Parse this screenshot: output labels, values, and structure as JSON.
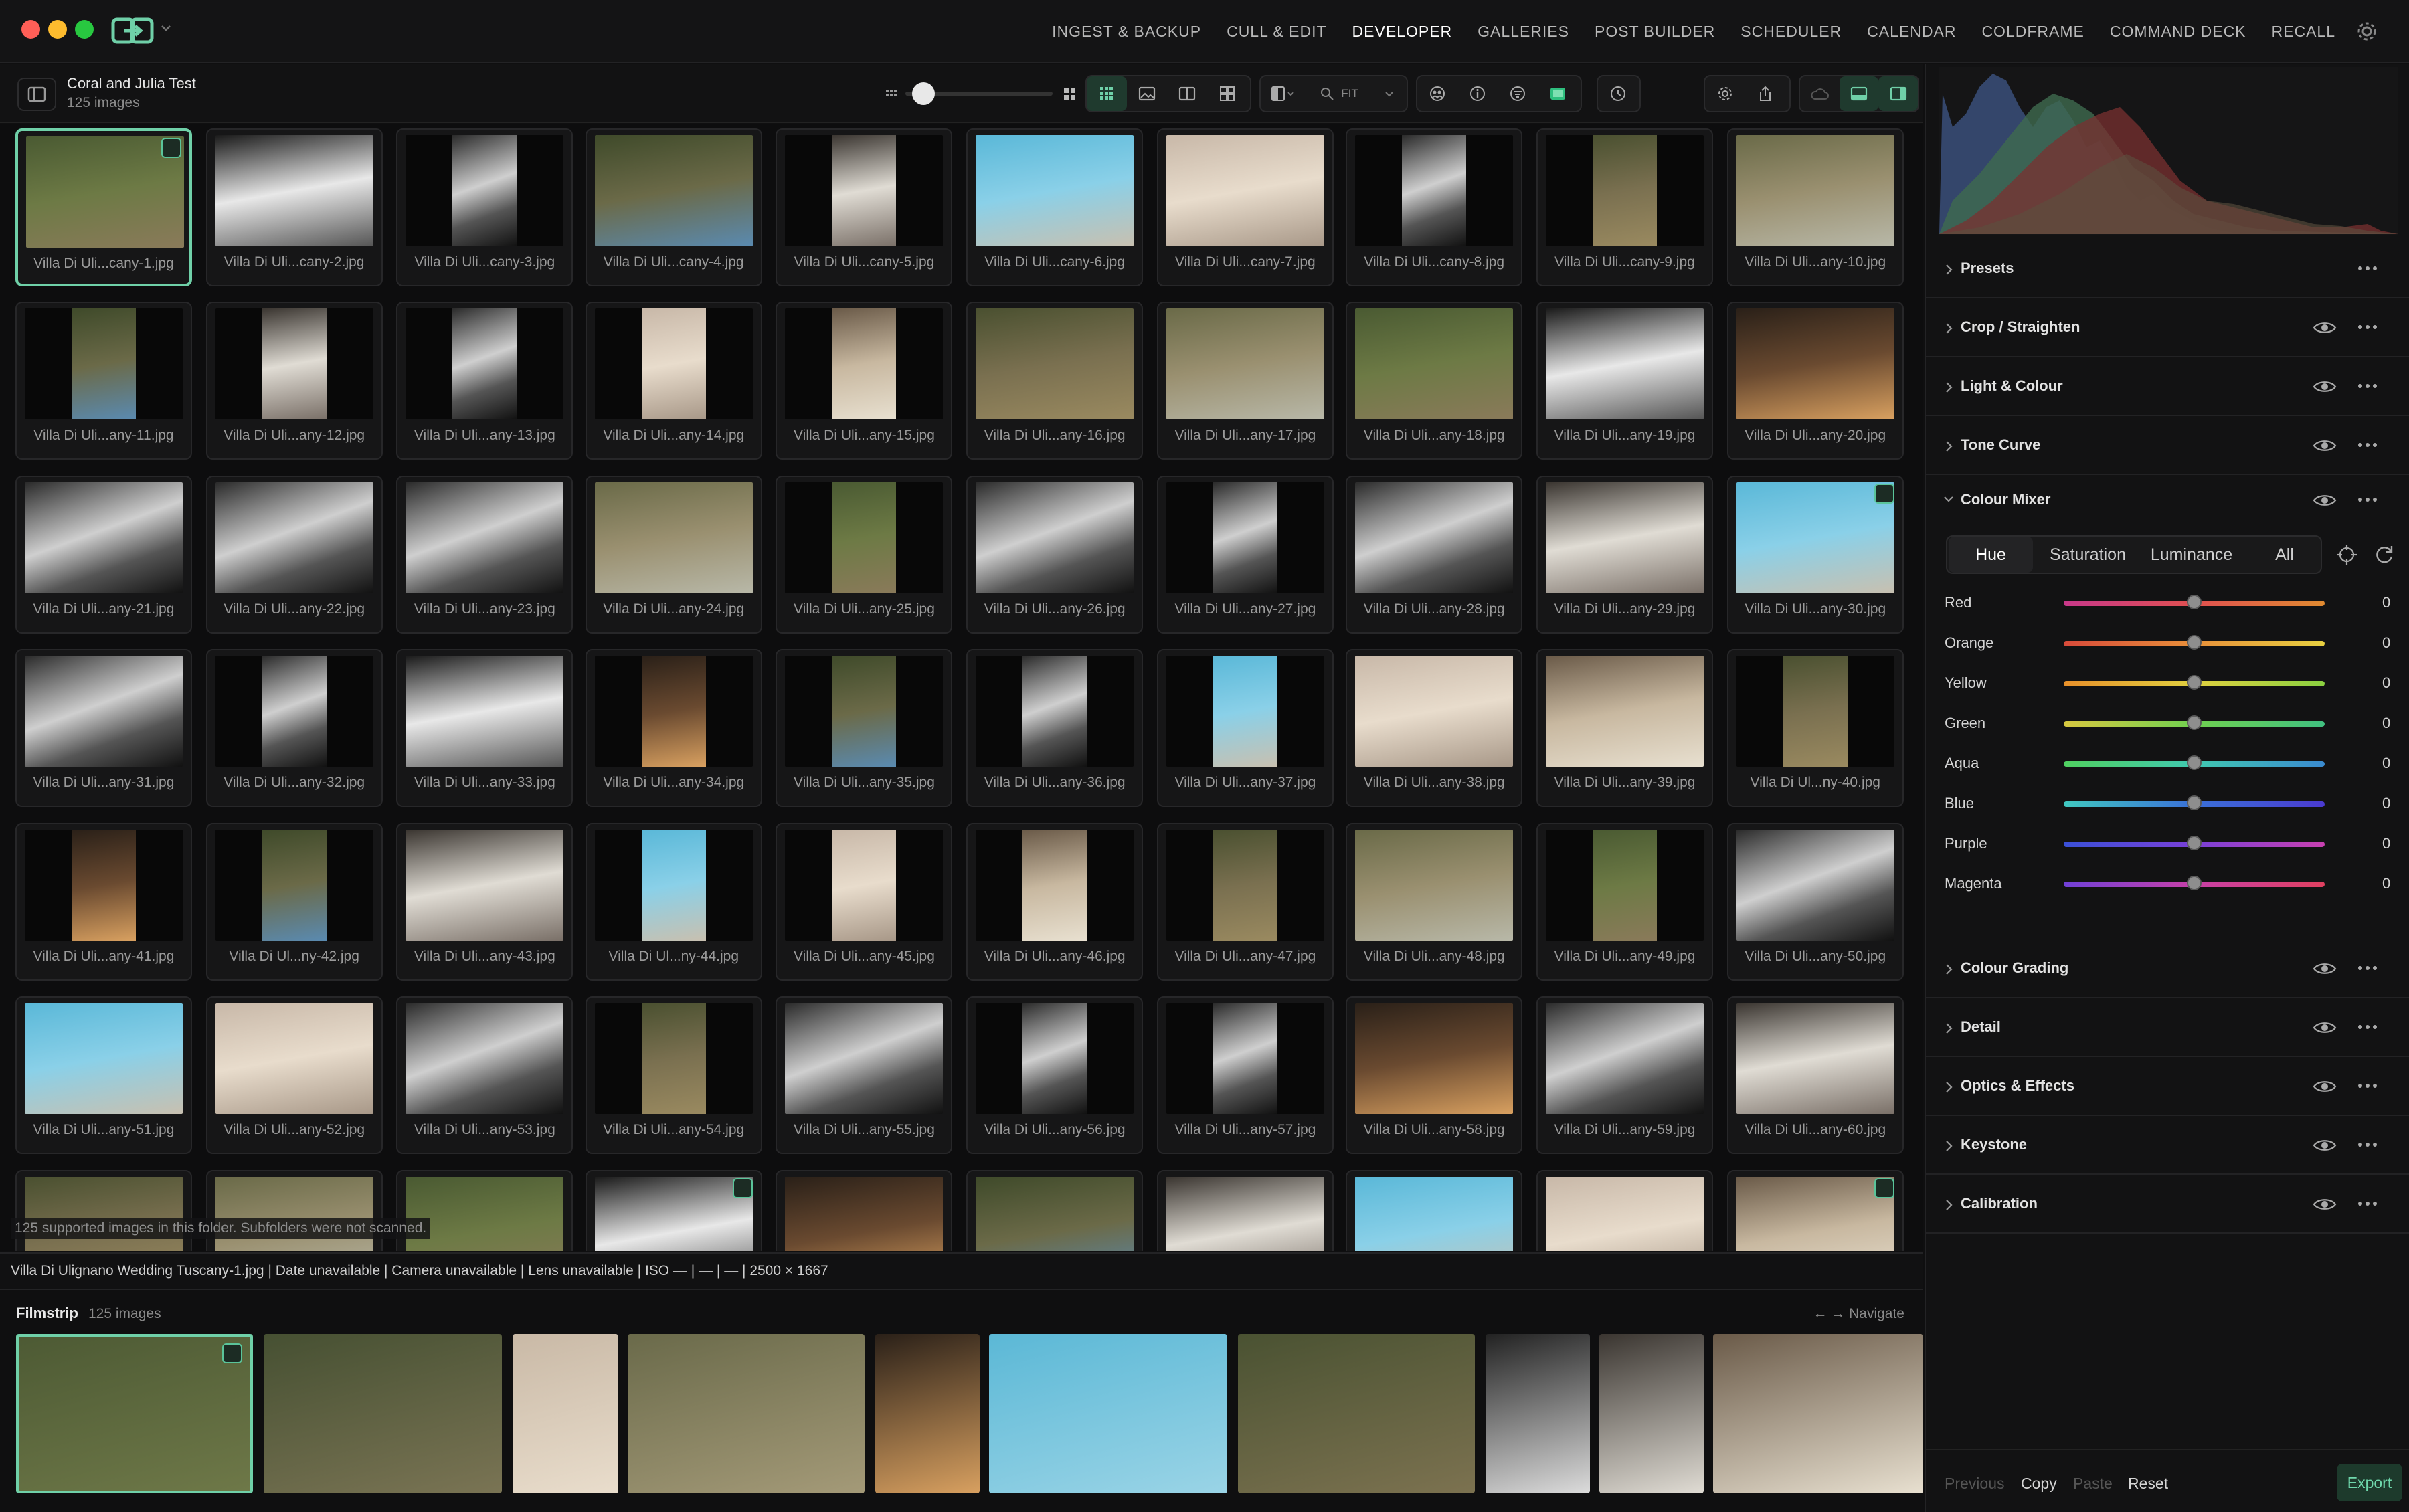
{
  "window": {
    "traffic_colors": [
      "#ff5f57",
      "#febc2e",
      "#28c840"
    ]
  },
  "nav": [
    {
      "label": "INGEST & BACKUP",
      "active": false
    },
    {
      "label": "CULL & EDIT",
      "active": false
    },
    {
      "label": "DEVELOPER",
      "active": true
    },
    {
      "label": "GALLERIES",
      "active": false
    },
    {
      "label": "POST BUILDER",
      "active": false
    },
    {
      "label": "SCHEDULER",
      "active": false
    },
    {
      "label": "CALENDAR",
      "active": false
    },
    {
      "label": "COLDFRAME",
      "active": false
    },
    {
      "label": "COMMAND DECK",
      "active": false
    },
    {
      "label": "RECALL",
      "active": false
    }
  ],
  "folder": {
    "name": "Coral and Julia Test",
    "count": "125 images"
  },
  "toolbar": {
    "fit_label": "FIT",
    "zoom_value": 0.1
  },
  "thumbnails": [
    "Villa Di Uli...cany-1.jpg",
    "Villa Di Uli...cany-2.jpg",
    "Villa Di Uli...cany-3.jpg",
    "Villa Di Uli...cany-4.jpg",
    "Villa Di Uli...cany-5.jpg",
    "Villa Di Uli...cany-6.jpg",
    "Villa Di Uli...cany-7.jpg",
    "Villa Di Uli...cany-8.jpg",
    "Villa Di Uli...cany-9.jpg",
    "Villa Di Uli...any-10.jpg",
    "Villa Di Uli...any-11.jpg",
    "Villa Di Uli...any-12.jpg",
    "Villa Di Uli...any-13.jpg",
    "Villa Di Uli...any-14.jpg",
    "Villa Di Uli...any-15.jpg",
    "Villa Di Uli...any-16.jpg",
    "Villa Di Uli...any-17.jpg",
    "Villa Di Uli...any-18.jpg",
    "Villa Di Uli...any-19.jpg",
    "Villa Di Uli...any-20.jpg",
    "Villa Di Uli...any-21.jpg",
    "Villa Di Uli...any-22.jpg",
    "Villa Di Uli...any-23.jpg",
    "Villa Di Uli...any-24.jpg",
    "Villa Di Uli...any-25.jpg",
    "Villa Di Uli...any-26.jpg",
    "Villa Di Uli...any-27.jpg",
    "Villa Di Uli...any-28.jpg",
    "Villa Di Uli...any-29.jpg",
    "Villa Di Uli...any-30.jpg",
    "Villa Di Uli...any-31.jpg",
    "Villa Di Uli...any-32.jpg",
    "Villa Di Uli...any-33.jpg",
    "Villa Di Uli...any-34.jpg",
    "Villa Di Uli...any-35.jpg",
    "Villa Di Uli...any-36.jpg",
    "Villa Di Uli...any-37.jpg",
    "Villa Di Uli...any-38.jpg",
    "Villa Di Uli...any-39.jpg",
    "Villa Di Ul...ny-40.jpg",
    "Villa Di Uli...any-41.jpg",
    "Villa Di Ul...ny-42.jpg",
    "Villa Di Uli...any-43.jpg",
    "Villa Di Ul...ny-44.jpg",
    "Villa Di Uli...any-45.jpg",
    "Villa Di Uli...any-46.jpg",
    "Villa Di Uli...any-47.jpg",
    "Villa Di Uli...any-48.jpg",
    "Villa Di Uli...any-49.jpg",
    "Villa Di Uli...any-50.jpg",
    "Villa Di Uli...any-51.jpg",
    "Villa Di Uli...any-52.jpg",
    "Villa Di Uli...any-53.jpg",
    "Villa Di Uli...any-54.jpg",
    "Villa Di Uli...any-55.jpg",
    "Villa Di Uli...any-56.jpg",
    "Villa Di Uli...any-57.jpg",
    "Villa Di Uli...any-58.jpg",
    "Villa Di Uli...any-59.jpg",
    "Villa Di Uli...any-60.jpg",
    "",
    "",
    "",
    "",
    "",
    "",
    "",
    "",
    "",
    ""
  ],
  "grid_note": "125 supported images in this folder. Subfolders were not scanned.",
  "status_line": "Villa Di Ulignano Wedding Tuscany-1.jpg | Date unavailable | Camera unavailable | Lens unavailable | ISO — | — | — | 2500 × 1667",
  "filmstrip": {
    "title": "Filmstrip",
    "count": "125 images",
    "nav_hint": "← → Navigate"
  },
  "panel": {
    "sections_top": [
      {
        "title": "Presets",
        "has_eye": false
      },
      {
        "title": "Crop / Straighten",
        "has_eye": true
      },
      {
        "title": "Light & Colour",
        "has_eye": true
      },
      {
        "title": "Tone Curve",
        "has_eye": true
      }
    ],
    "mixer": {
      "title": "Colour Mixer",
      "tabs": [
        "Hue",
        "Saturation",
        "Luminance",
        "All"
      ],
      "active_tab": "Hue",
      "rows": [
        {
          "label": "Red",
          "value": "0"
        },
        {
          "label": "Orange",
          "value": "0"
        },
        {
          "label": "Yellow",
          "value": "0"
        },
        {
          "label": "Green",
          "value": "0"
        },
        {
          "label": "Aqua",
          "value": "0"
        },
        {
          "label": "Blue",
          "value": "0"
        },
        {
          "label": "Purple",
          "value": "0"
        },
        {
          "label": "Magenta",
          "value": "0"
        }
      ]
    },
    "sections_bottom": [
      {
        "title": "Colour Grading"
      },
      {
        "title": "Detail"
      },
      {
        "title": "Optics & Effects"
      },
      {
        "title": "Keystone"
      },
      {
        "title": "Calibration"
      }
    ],
    "bottom": {
      "previous": "Previous",
      "copy": "Copy",
      "paste": "Paste",
      "reset": "Reset",
      "export": "Export"
    }
  },
  "colors": {
    "accent": "#6fd0a8",
    "background": "#0f0f10"
  }
}
